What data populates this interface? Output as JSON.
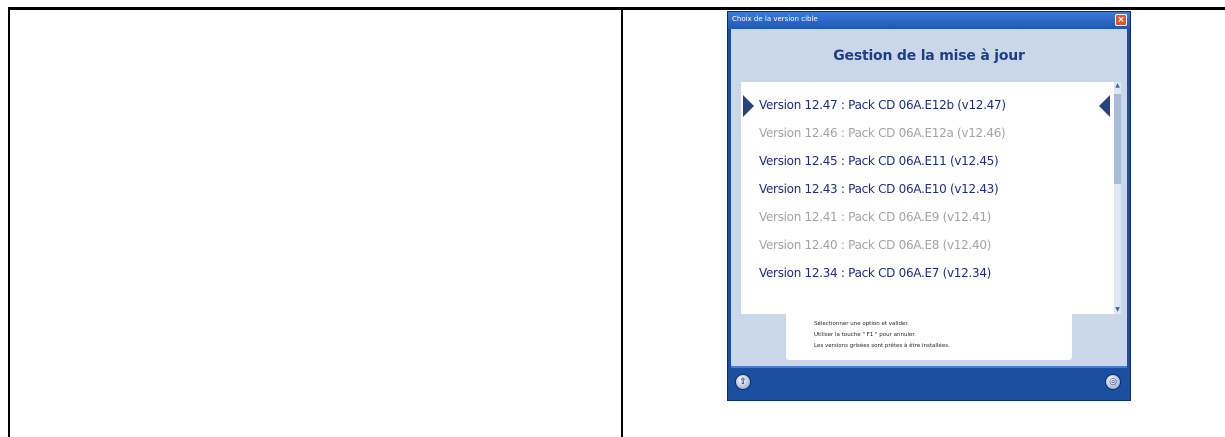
{
  "window": {
    "title": "Choix de la version cible",
    "close_label": "×"
  },
  "header": {
    "title": "Gestion de la mise à jour"
  },
  "versions": [
    {
      "label": "Version 12.47 : Pack CD 06A.E12b (v12.47)",
      "state": "selected"
    },
    {
      "label": "Version 12.46 : Pack CD 06A.E12a (v12.46)",
      "state": "disabled"
    },
    {
      "label": "Version 12.45 : Pack CD 06A.E11 (v12.45)",
      "state": "available"
    },
    {
      "label": "Version 12.43 : Pack CD 06A.E10 (v12.43)",
      "state": "available"
    },
    {
      "label": "Version 12.41 : Pack CD 06A.E9 (v12.41)",
      "state": "disabled"
    },
    {
      "label": "Version 12.40 : Pack CD 06A.E8 (v12.40)",
      "state": "disabled"
    },
    {
      "label": "Version 12.34 : Pack CD 06A.E7 (v12.34)",
      "state": "available"
    }
  ],
  "info": {
    "line1": "Sélectionner une option et valider.",
    "line2": "Utiliser la touche \" F1 \" pour annuler.",
    "line3": "Les versions grisées sont prêtes à être installées."
  },
  "footer": {
    "left_icon": "up-arrow-icon",
    "right_icon": "network-icon"
  },
  "colors": {
    "window_blue": "#1b4fa0",
    "client_bg": "#c9d7e8",
    "title_text": "#1d3d87",
    "available_text": "#1d2f7a",
    "disabled_text": "#a3a3a3"
  }
}
